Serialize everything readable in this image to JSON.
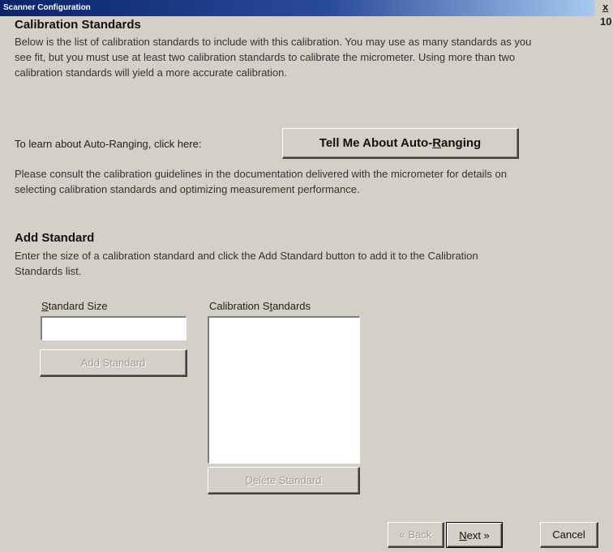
{
  "window": {
    "title": "Scanner Configuration",
    "close_glyph": "x",
    "corner_number": "10"
  },
  "calibration": {
    "heading": "Calibration Standards",
    "intro": "Below is the list of calibration standards to include with this calibration.  You may use as many standards as you see fit, but you must use at least two calibration standards to calibrate the micrometer.  Using more than two calibration standards will yield a more accurate calibration.",
    "autorange_prompt": "To learn about Auto-Ranging, click here:",
    "autorange_button": {
      "pre": "Tell Me About Auto-",
      "key": "R",
      "post": "anging"
    },
    "guidelines": "Please consult the calibration guidelines in the documentation delivered with the micrometer for details on selecting calibration standards and optimizing measurement performance."
  },
  "add_standard": {
    "heading": "Add Standard",
    "instructions": "Enter the size of a calibration standard and click the Add Standard button to add it to the Calibration Standards list.",
    "size_label": {
      "key": "S",
      "rest": "tandard Size"
    },
    "size_value": "",
    "add_button": "Add Standard",
    "list_label": {
      "pre": "Calibration S",
      "key": "t",
      "post": "andards"
    },
    "list_items": [],
    "delete_button": {
      "key": "D",
      "rest": "elete Standard"
    }
  },
  "footer": {
    "back_button": "« Back",
    "next_button": {
      "key": "N",
      "rest": "ext »"
    },
    "cancel_button": "Cancel"
  }
}
